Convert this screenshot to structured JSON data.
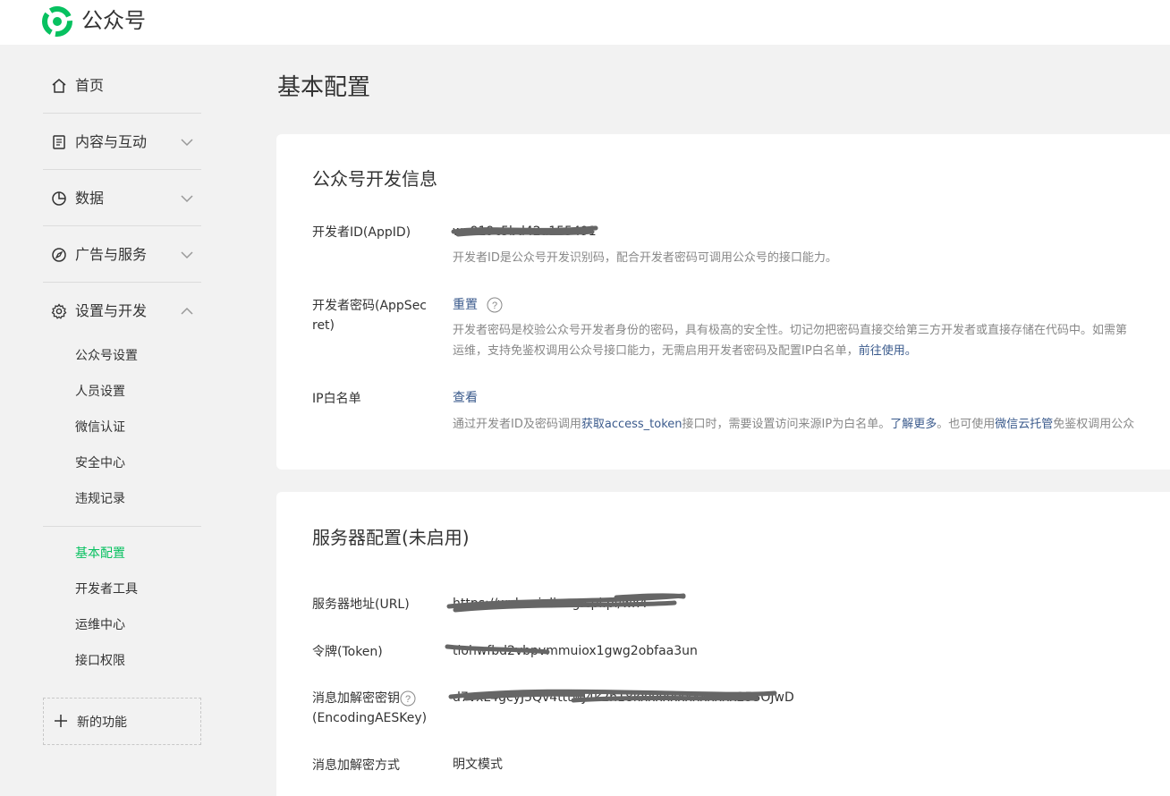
{
  "header": {
    "app_name": "公众号",
    "logo_icon": "wechat-mp-logo-icon",
    "brand_color": "#07c160"
  },
  "sidebar": {
    "main_items": [
      {
        "label": "首页",
        "icon": "home-icon"
      },
      {
        "label": "内容与互动",
        "icon": "document-icon"
      },
      {
        "label": "数据",
        "icon": "pie-chart-icon"
      },
      {
        "label": "广告与服务",
        "icon": "compass-icon"
      },
      {
        "label": "设置与开发",
        "icon": "gear-icon"
      }
    ],
    "settings_sub": [
      "公众号设置",
      "人员设置",
      "微信认证",
      "安全中心",
      "违规记录"
    ],
    "dev_sub": [
      "基本配置",
      "开发者工具",
      "运维中心",
      "接口权限"
    ],
    "active_item": "基本配置",
    "new_feature": "新的功能"
  },
  "page": {
    "title": "基本配置"
  },
  "dev_info": {
    "title": "公众号开发信息",
    "appid_label": "开发者ID(AppID)",
    "appid_value": "wx919c5bd42a155491",
    "appid_desc": "开发者ID是公众号开发识别码，配合开发者密码可调用公众号的接口能力。",
    "secret_label_1": "开发者密码(AppSec",
    "secret_label_2": "ret)",
    "secret_reset": "重置",
    "secret_desc_1": "开发者密码是校验公众号开发者身份的密码，具有极高的安全性。切记勿把密码直接交给第三方开发者或直接存储在代码中。如需第",
    "secret_desc_2a": "运维，支持免鉴权调用公众号接口能力，无需启用开发者密码及配置IP白名单，",
    "secret_desc_2_link": "前往使用。",
    "ip_label": "IP白名单",
    "ip_view": "查看",
    "ip_desc_1": "通过开发者ID及密码调用",
    "ip_desc_link1": "获取access_token",
    "ip_desc_2": "接口时，需要设置访问来源IP为白名单。",
    "ip_desc_link2": "了解更多",
    "ip_desc_3": "。也可使用",
    "ip_desc_link3": "微信云托管",
    "ip_desc_4": "免鉴权调用公众"
  },
  "server": {
    "title": "服务器配置(未启用)",
    "url_label": "服务器地址(URL)",
    "url_value": "https://wxhexinliang.cpl.pl/wx4",
    "token_label": "令牌(Token)",
    "token_value": "tlohwfbd2vbpvmmuiox1gwg2obfaa3un",
    "aes_label_1": "消息加解密密钥",
    "aes_label_2": "(EncodingAESKey)",
    "aes_value": "d7vxL4gcyJ5Qv4tttwJ4k2h18kxxxxxxxxxxxxx253OJwD",
    "mode_label": "消息加解密方式",
    "mode_value": "明文模式"
  }
}
